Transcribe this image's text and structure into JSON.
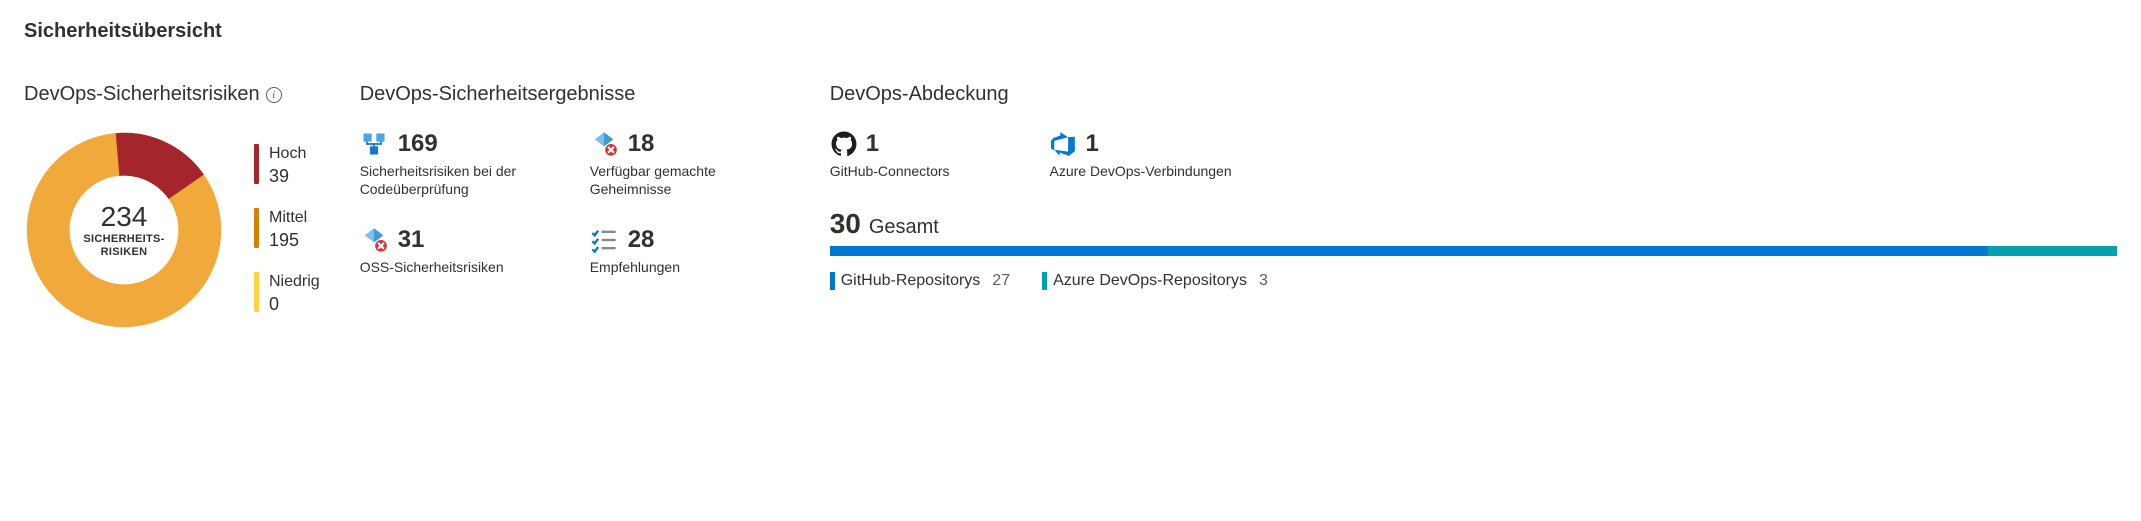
{
  "title": "Sicherheitsübersicht",
  "risks": {
    "heading": "DevOps-Sicherheitsrisiken",
    "total": "234",
    "total_label_line1": "SICHERHEITS-",
    "total_label_line2": "RISIKEN",
    "legend": {
      "high": {
        "label": "Hoch",
        "value": "39",
        "color": "#a4262c"
      },
      "medium": {
        "label": "Mittel",
        "value": "195",
        "color": "#d67f00"
      },
      "low": {
        "label": "Niedrig",
        "value": "0",
        "color": "#ffd23f"
      }
    }
  },
  "findings": {
    "heading": "DevOps-Sicherheitsergebnisse",
    "code": {
      "value": "169",
      "label": "Sicherheitsrisiken bei der Codeüberprüfung"
    },
    "secrets": {
      "value": "18",
      "label": "Verfügbar gemachte Geheimnisse"
    },
    "oss": {
      "value": "31",
      "label": "OSS-Sicherheitsrisiken"
    },
    "recs": {
      "value": "28",
      "label": "Empfehlungen"
    }
  },
  "coverage": {
    "heading": "DevOps-Abdeckung",
    "github": {
      "value": "1",
      "label": "GitHub-Connectors"
    },
    "azdo": {
      "value": "1",
      "label": "Azure DevOps-Verbindungen"
    },
    "total": {
      "value": "30",
      "label": "Gesamt"
    },
    "bar": {
      "github": {
        "label": "GitHub-Repositorys",
        "value": "27",
        "pct": 90,
        "color": "#0078d4"
      },
      "azdo": {
        "label": "Azure DevOps-Repositorys",
        "value": "3",
        "pct": 10,
        "color": "#00a2ad"
      }
    }
  },
  "chart_data": {
    "type": "pie",
    "title": "DevOps-Sicherheitsrisiken",
    "categories": [
      "Hoch",
      "Mittel",
      "Niedrig"
    ],
    "values": [
      39,
      195,
      0
    ],
    "colors": [
      "#a4262c",
      "#f2a93b",
      "#ffd23f"
    ],
    "center_value": 234,
    "center_label": "SICHERHEITSRISIKEN"
  }
}
